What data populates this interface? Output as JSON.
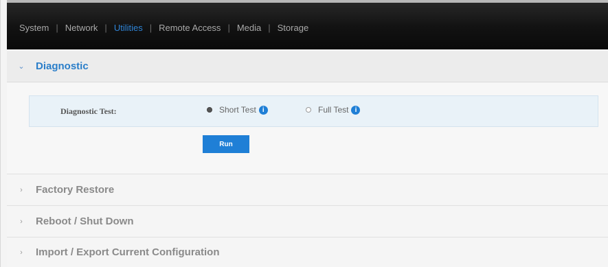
{
  "nav": {
    "tabs": [
      {
        "label": "System",
        "active": false
      },
      {
        "label": "Network",
        "active": false
      },
      {
        "label": "Utilities",
        "active": true
      },
      {
        "label": "Remote Access",
        "active": false
      },
      {
        "label": "Media",
        "active": false
      },
      {
        "label": "Storage",
        "active": false
      }
    ],
    "separator": "|"
  },
  "sections": {
    "diagnostic": {
      "title": "Diagnostic",
      "expanded": true,
      "chevron": "⌄",
      "test_label": "Diagnostic Test:",
      "options": [
        {
          "label": "Short Test",
          "selected": true
        },
        {
          "label": "Full Test",
          "selected": false
        }
      ],
      "info_glyph": "i",
      "run_label": "Run"
    },
    "factory": {
      "title": "Factory Restore",
      "chevron": "›"
    },
    "reboot": {
      "title": "Reboot / Shut Down",
      "chevron": "›"
    },
    "import": {
      "title": "Import / Export Current Configuration",
      "chevron": "›"
    }
  },
  "colors": {
    "accent": "#2a7ec9",
    "nav_bg": "#121212",
    "button": "#1f7fd6"
  }
}
